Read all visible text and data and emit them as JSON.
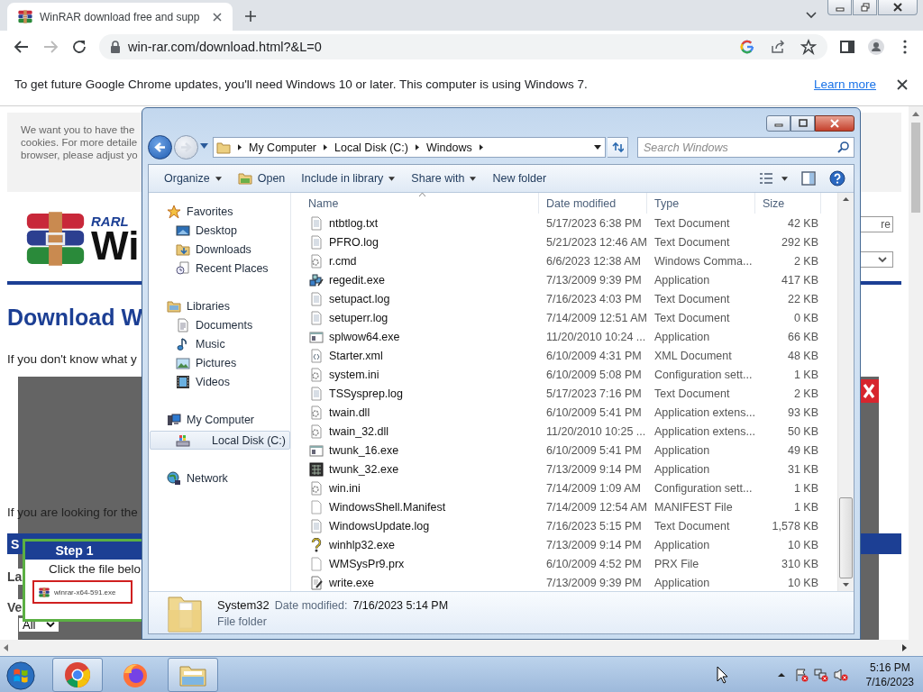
{
  "browser": {
    "tabs": [
      {
        "title": "WinRAR download free and supp",
        "selected": true
      }
    ],
    "back_disabled": false,
    "forward_disabled": true,
    "url": "win-rar.com/download.html?&L=0",
    "infobar": {
      "message": "To get future Google Chrome updates, you'll need Windows 10 or later. This computer is using Windows 7.",
      "link": "Learn more"
    }
  },
  "webpage": {
    "cookie_notice": [
      "We want you to have the",
      "cookies. For more detaile",
      "browser, please adjust yo"
    ],
    "logo": {
      "brand": "RARL",
      "name": "Wi"
    },
    "right_field": "re",
    "heading": "Download W",
    "intro": "If you don't know what y",
    "note": "If you are looking for the",
    "section_bar": "S",
    "labels": [
      "La",
      "Ve"
    ],
    "select": "All",
    "step": {
      "title": "Step 1",
      "text": "Click the file belo",
      "file": "winrar-x64-591.exe"
    }
  },
  "explorer": {
    "back_disabled": false,
    "forward_disabled": true,
    "breadcrumb": [
      "My Computer",
      "Local Disk (C:)",
      "Windows"
    ],
    "search": {
      "placeholder": "Search Windows"
    },
    "commands": [
      {
        "label": "Organize",
        "kind": "plain",
        "dropdown": true
      },
      {
        "label": "Open",
        "kind": "icon",
        "dropdown": false
      },
      {
        "label": "Include in library",
        "kind": "plain",
        "dropdown": true
      },
      {
        "label": "Share with",
        "kind": "plain",
        "dropdown": true
      },
      {
        "label": "New folder",
        "kind": "plain",
        "dropdown": false
      }
    ],
    "nav": [
      {
        "label": "Favorites",
        "kind": "star",
        "selected": false,
        "children": [
          {
            "label": "Desktop",
            "kind": "desktop",
            "selected": false
          },
          {
            "label": "Downloads",
            "kind": "downloads",
            "selected": false
          },
          {
            "label": "Recent Places",
            "kind": "recent",
            "selected": false
          }
        ]
      },
      {
        "label": "Libraries",
        "kind": "library",
        "selected": false,
        "children": [
          {
            "label": "Documents",
            "kind": "documents",
            "selected": false
          },
          {
            "label": "Music",
            "kind": "music",
            "selected": false
          },
          {
            "label": "Pictures",
            "kind": "pictures",
            "selected": false
          },
          {
            "label": "Videos",
            "kind": "videos",
            "selected": false
          }
        ]
      },
      {
        "label": "My Computer",
        "kind": "computer",
        "selected": false,
        "children": [
          {
            "label": "Local Disk (C:)",
            "kind": "drive",
            "selected": true
          }
        ]
      },
      {
        "label": "Network",
        "kind": "network",
        "selected": false
      }
    ],
    "columns": [
      {
        "label": "Name",
        "sorted": true
      },
      {
        "label": "Date modified",
        "sorted": false
      },
      {
        "label": "Type",
        "sorted": false
      },
      {
        "label": "Size",
        "sorted": false
      }
    ],
    "rows": [
      {
        "kind": "doc",
        "name": "ntbtlog.txt",
        "date": "5/17/2023 6:38 PM",
        "type": "Text Document",
        "size": "42 KB"
      },
      {
        "kind": "doc",
        "name": "PFRO.log",
        "date": "5/21/2023 12:46 AM",
        "type": "Text Document",
        "size": "292 KB"
      },
      {
        "kind": "gear",
        "name": "r.cmd",
        "date": "6/6/2023 12:38 AM",
        "type": "Windows Comma...",
        "size": "2 KB"
      },
      {
        "kind": "cubes",
        "name": "regedit.exe",
        "date": "7/13/2009 9:39 PM",
        "type": "Application",
        "size": "417 KB"
      },
      {
        "kind": "doc",
        "name": "setupact.log",
        "date": "7/16/2023 4:03 PM",
        "type": "Text Document",
        "size": "22 KB"
      },
      {
        "kind": "doc",
        "name": "setuperr.log",
        "date": "7/14/2009 12:51 AM",
        "type": "Text Document",
        "size": "0 KB"
      },
      {
        "kind": "app",
        "name": "splwow64.exe",
        "date": "11/20/2010 10:24 ...",
        "type": "Application",
        "size": "66 KB"
      },
      {
        "kind": "xml",
        "name": "Starter.xml",
        "date": "6/10/2009 4:31 PM",
        "type": "XML Document",
        "size": "48 KB"
      },
      {
        "kind": "gear",
        "name": "system.ini",
        "date": "6/10/2009 5:08 PM",
        "type": "Configuration sett...",
        "size": "1 KB"
      },
      {
        "kind": "doc",
        "name": "TSSysprep.log",
        "date": "5/17/2023 7:16 PM",
        "type": "Text Document",
        "size": "2 KB"
      },
      {
        "kind": "gear",
        "name": "twain.dll",
        "date": "6/10/2009 5:41 PM",
        "type": "Application extens...",
        "size": "93 KB"
      },
      {
        "kind": "gear",
        "name": "twain_32.dll",
        "date": "11/20/2010 10:25 ...",
        "type": "Application extens...",
        "size": "50 KB"
      },
      {
        "kind": "app",
        "name": "twunk_16.exe",
        "date": "6/10/2009 5:41 PM",
        "type": "Application",
        "size": "49 KB"
      },
      {
        "kind": "grid",
        "name": "twunk_32.exe",
        "date": "7/13/2009 9:14 PM",
        "type": "Application",
        "size": "31 KB"
      },
      {
        "kind": "gear",
        "name": "win.ini",
        "date": "7/14/2009 1:09 AM",
        "type": "Configuration sett...",
        "size": "1 KB"
      },
      {
        "kind": "blank",
        "name": "WindowsShell.Manifest",
        "date": "7/14/2009 12:54 AM",
        "type": "MANIFEST File",
        "size": "1 KB"
      },
      {
        "kind": "doc",
        "name": "WindowsUpdate.log",
        "date": "7/16/2023 5:15 PM",
        "type": "Text Document",
        "size": "1,578 KB"
      },
      {
        "kind": "help",
        "name": "winhlp32.exe",
        "date": "7/13/2009 9:14 PM",
        "type": "Application",
        "size": "10 KB"
      },
      {
        "kind": "blank",
        "name": "WMSysPr9.prx",
        "date": "6/10/2009 4:52 PM",
        "type": "PRX File",
        "size": "310 KB"
      },
      {
        "kind": "write",
        "name": "write.exe",
        "date": "7/13/2009 9:39 PM",
        "type": "Application",
        "size": "10 KB"
      }
    ],
    "details": {
      "name": "System32",
      "date_label": "Date modified:",
      "date": "7/16/2023 5:14 PM",
      "type": "File folder"
    }
  },
  "taskbar": {
    "apps": [
      {
        "kind": "chrome",
        "open": true
      },
      {
        "kind": "firefox",
        "open": false
      },
      {
        "kind": "explorer",
        "open": true
      }
    ],
    "time": "5:16 PM",
    "date": "7/16/2023"
  }
}
